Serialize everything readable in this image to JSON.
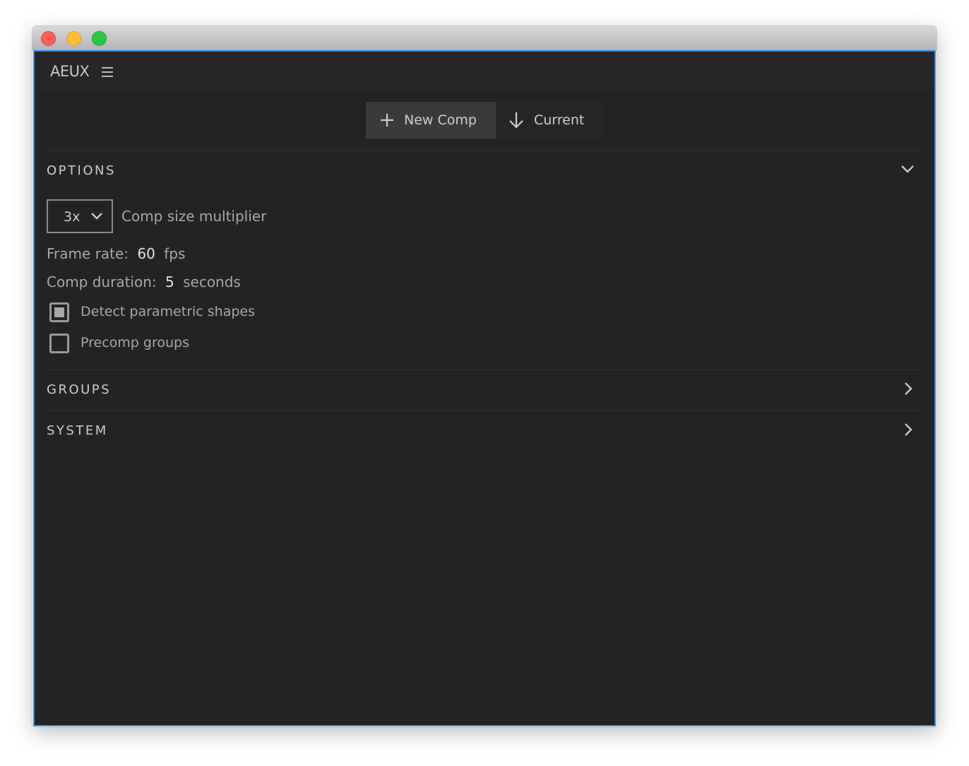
{
  "app": {
    "title": "AEUX"
  },
  "toolbar": {
    "new_comp": "New Comp",
    "current": "Current"
  },
  "options": {
    "title": "OPTIONS",
    "multiplier": {
      "value": "3x",
      "label": "Comp size multiplier"
    },
    "frame_rate": {
      "label": "Frame rate:",
      "value": "60",
      "unit": "fps"
    },
    "duration": {
      "label": "Comp duration:",
      "value": "5",
      "unit": "seconds"
    },
    "detect_shapes": {
      "label": "Detect parametric shapes",
      "checked": true
    },
    "precomp_groups": {
      "label": "Precomp groups",
      "checked": false
    }
  },
  "groups": {
    "title": "GROUPS"
  },
  "system": {
    "title": "SYSTEM"
  },
  "colors": {
    "accent": "#2d8ceb",
    "background": "#232323"
  }
}
